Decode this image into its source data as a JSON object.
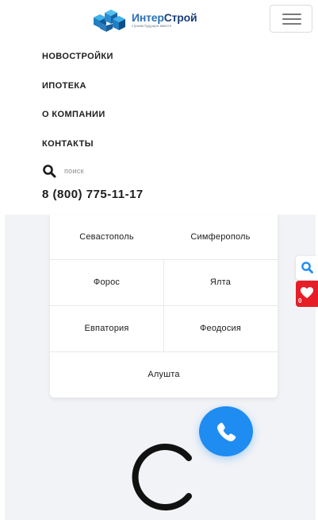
{
  "header": {
    "logo": {
      "name_part1": "Интер",
      "name_part2": "Строй",
      "tagline": "строим будущее вместе"
    },
    "menu_button_icon": "hamburger-icon"
  },
  "nav": {
    "items": [
      {
        "label": "НОВОСТРОЙКИ"
      },
      {
        "label": "ИПОТЕКА"
      },
      {
        "label": "О КОМПАНИИ"
      },
      {
        "label": "КОНТАКТЫ"
      }
    ]
  },
  "search": {
    "label": "поиск",
    "icon": "search-icon"
  },
  "contact": {
    "phone": "8 (800) 775-11-17"
  },
  "cities": {
    "items": [
      {
        "label": "Севастополь"
      },
      {
        "label": "Симферополь"
      },
      {
        "label": "Форос"
      },
      {
        "label": "Ялта"
      },
      {
        "label": "Евпатория"
      },
      {
        "label": "Феодосия"
      },
      {
        "label": "Алушта"
      }
    ]
  },
  "side_panel": {
    "search_icon": "search-icon",
    "favorites_icon": "heart-icon",
    "favorites_count": "0"
  },
  "call_button": {
    "icon": "phone-icon"
  },
  "loader": {
    "icon": "spinner-icon"
  },
  "colors": {
    "accent_blue": "#1f8cf2",
    "favorites_red": "#e61e27",
    "section_bg": "#f1f3f6",
    "logo_blue": "#2c6fb4",
    "logo_dark": "#1c3f79"
  }
}
